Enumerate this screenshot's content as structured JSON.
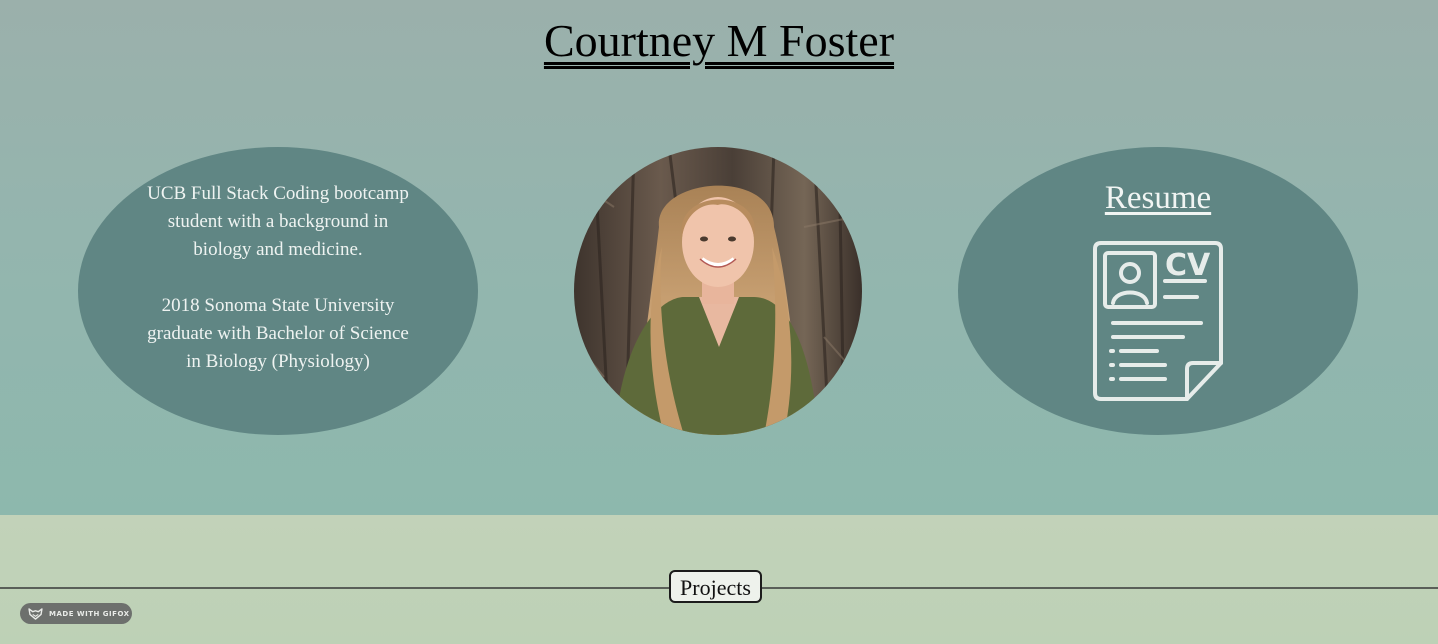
{
  "header": {
    "name": "Courtney M Foster"
  },
  "about": {
    "paragraph_1": "UCB Full Stack Coding bootcamp student with a background in biology and medicine.",
    "paragraph_2": "2018 Sonoma State University graduate with Bachelor of Science in Biology (Physiology)"
  },
  "profile_photo": {
    "icon": "portrait-photo"
  },
  "resume": {
    "link_label": "Resume",
    "icon": "cv-document-icon",
    "icon_text": "CV"
  },
  "projects": {
    "button_label": "Projects"
  },
  "badge": {
    "label": "MADE WITH GIFOX"
  },
  "colors": {
    "hero_top": "#9bb0ab",
    "hero_bottom": "#8db8ad",
    "pill": "#608684",
    "projects_band": "#c2d2b9"
  }
}
